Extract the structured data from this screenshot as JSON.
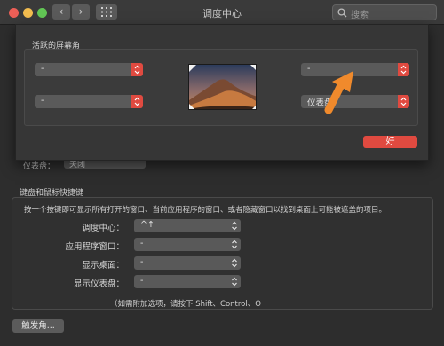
{
  "window": {
    "title": "调度中心",
    "search_placeholder": "搜索",
    "back_icon": "‹",
    "forward_icon": "›"
  },
  "background": {
    "dashboard_label": "仪表盘：",
    "dashboard_value": "关闭"
  },
  "keyboard": {
    "section_title": "键盘和鼠标快捷键",
    "description": "按一个按键即可显示所有打开的窗口、当前应用程序的窗口、或者隐藏窗口以找到桌面上可能被遮盖的项目。",
    "rows": [
      {
        "label": "调度中心：",
        "value": "^↑"
      },
      {
        "label": "应用程序窗口：",
        "value": "-"
      },
      {
        "label": "显示桌面：",
        "value": "-"
      },
      {
        "label": "显示仪表盘：",
        "value": "-"
      }
    ],
    "hint": "（如需附加选项，请按下 Shift、Control、O",
    "trigger_button": "触发角..."
  },
  "sheet": {
    "title": "活跃的屏幕角",
    "corners": {
      "top_left": "-",
      "top_right": "-",
      "bottom_left": "-",
      "bottom_right": "仪表盘"
    },
    "ok_button": "好"
  },
  "colors": {
    "accent_red": "#e04a40",
    "arrow_orange": "#f08a2c"
  }
}
